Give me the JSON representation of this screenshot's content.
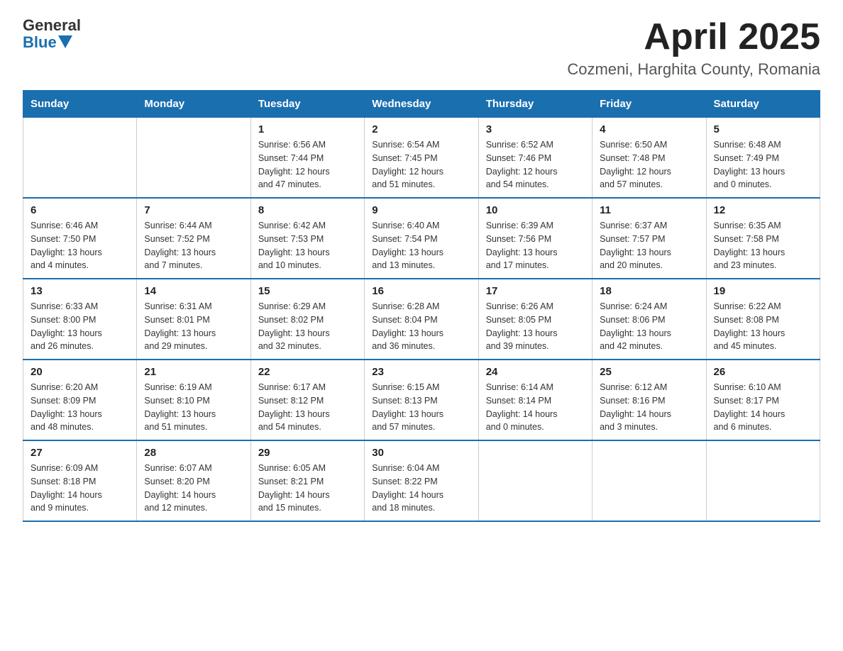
{
  "header": {
    "logo_general": "General",
    "logo_blue": "Blue",
    "title": "April 2025",
    "subtitle": "Cozmeni, Harghita County, Romania"
  },
  "calendar": {
    "days_of_week": [
      "Sunday",
      "Monday",
      "Tuesday",
      "Wednesday",
      "Thursday",
      "Friday",
      "Saturday"
    ],
    "weeks": [
      [
        {
          "day": "",
          "info": ""
        },
        {
          "day": "",
          "info": ""
        },
        {
          "day": "1",
          "info": "Sunrise: 6:56 AM\nSunset: 7:44 PM\nDaylight: 12 hours\nand 47 minutes."
        },
        {
          "day": "2",
          "info": "Sunrise: 6:54 AM\nSunset: 7:45 PM\nDaylight: 12 hours\nand 51 minutes."
        },
        {
          "day": "3",
          "info": "Sunrise: 6:52 AM\nSunset: 7:46 PM\nDaylight: 12 hours\nand 54 minutes."
        },
        {
          "day": "4",
          "info": "Sunrise: 6:50 AM\nSunset: 7:48 PM\nDaylight: 12 hours\nand 57 minutes."
        },
        {
          "day": "5",
          "info": "Sunrise: 6:48 AM\nSunset: 7:49 PM\nDaylight: 13 hours\nand 0 minutes."
        }
      ],
      [
        {
          "day": "6",
          "info": "Sunrise: 6:46 AM\nSunset: 7:50 PM\nDaylight: 13 hours\nand 4 minutes."
        },
        {
          "day": "7",
          "info": "Sunrise: 6:44 AM\nSunset: 7:52 PM\nDaylight: 13 hours\nand 7 minutes."
        },
        {
          "day": "8",
          "info": "Sunrise: 6:42 AM\nSunset: 7:53 PM\nDaylight: 13 hours\nand 10 minutes."
        },
        {
          "day": "9",
          "info": "Sunrise: 6:40 AM\nSunset: 7:54 PM\nDaylight: 13 hours\nand 13 minutes."
        },
        {
          "day": "10",
          "info": "Sunrise: 6:39 AM\nSunset: 7:56 PM\nDaylight: 13 hours\nand 17 minutes."
        },
        {
          "day": "11",
          "info": "Sunrise: 6:37 AM\nSunset: 7:57 PM\nDaylight: 13 hours\nand 20 minutes."
        },
        {
          "day": "12",
          "info": "Sunrise: 6:35 AM\nSunset: 7:58 PM\nDaylight: 13 hours\nand 23 minutes."
        }
      ],
      [
        {
          "day": "13",
          "info": "Sunrise: 6:33 AM\nSunset: 8:00 PM\nDaylight: 13 hours\nand 26 minutes."
        },
        {
          "day": "14",
          "info": "Sunrise: 6:31 AM\nSunset: 8:01 PM\nDaylight: 13 hours\nand 29 minutes."
        },
        {
          "day": "15",
          "info": "Sunrise: 6:29 AM\nSunset: 8:02 PM\nDaylight: 13 hours\nand 32 minutes."
        },
        {
          "day": "16",
          "info": "Sunrise: 6:28 AM\nSunset: 8:04 PM\nDaylight: 13 hours\nand 36 minutes."
        },
        {
          "day": "17",
          "info": "Sunrise: 6:26 AM\nSunset: 8:05 PM\nDaylight: 13 hours\nand 39 minutes."
        },
        {
          "day": "18",
          "info": "Sunrise: 6:24 AM\nSunset: 8:06 PM\nDaylight: 13 hours\nand 42 minutes."
        },
        {
          "day": "19",
          "info": "Sunrise: 6:22 AM\nSunset: 8:08 PM\nDaylight: 13 hours\nand 45 minutes."
        }
      ],
      [
        {
          "day": "20",
          "info": "Sunrise: 6:20 AM\nSunset: 8:09 PM\nDaylight: 13 hours\nand 48 minutes."
        },
        {
          "day": "21",
          "info": "Sunrise: 6:19 AM\nSunset: 8:10 PM\nDaylight: 13 hours\nand 51 minutes."
        },
        {
          "day": "22",
          "info": "Sunrise: 6:17 AM\nSunset: 8:12 PM\nDaylight: 13 hours\nand 54 minutes."
        },
        {
          "day": "23",
          "info": "Sunrise: 6:15 AM\nSunset: 8:13 PM\nDaylight: 13 hours\nand 57 minutes."
        },
        {
          "day": "24",
          "info": "Sunrise: 6:14 AM\nSunset: 8:14 PM\nDaylight: 14 hours\nand 0 minutes."
        },
        {
          "day": "25",
          "info": "Sunrise: 6:12 AM\nSunset: 8:16 PM\nDaylight: 14 hours\nand 3 minutes."
        },
        {
          "day": "26",
          "info": "Sunrise: 6:10 AM\nSunset: 8:17 PM\nDaylight: 14 hours\nand 6 minutes."
        }
      ],
      [
        {
          "day": "27",
          "info": "Sunrise: 6:09 AM\nSunset: 8:18 PM\nDaylight: 14 hours\nand 9 minutes."
        },
        {
          "day": "28",
          "info": "Sunrise: 6:07 AM\nSunset: 8:20 PM\nDaylight: 14 hours\nand 12 minutes."
        },
        {
          "day": "29",
          "info": "Sunrise: 6:05 AM\nSunset: 8:21 PM\nDaylight: 14 hours\nand 15 minutes."
        },
        {
          "day": "30",
          "info": "Sunrise: 6:04 AM\nSunset: 8:22 PM\nDaylight: 14 hours\nand 18 minutes."
        },
        {
          "day": "",
          "info": ""
        },
        {
          "day": "",
          "info": ""
        },
        {
          "day": "",
          "info": ""
        }
      ]
    ]
  }
}
